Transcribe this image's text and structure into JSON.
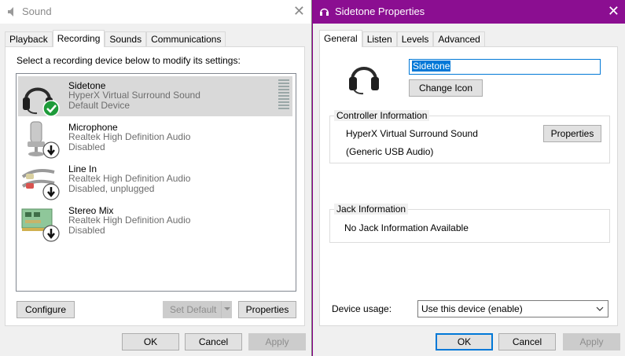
{
  "left_window": {
    "title": "Sound",
    "close_symbol": "✕",
    "tabs": [
      {
        "label": "Playback"
      },
      {
        "label": "Recording"
      },
      {
        "label": "Sounds"
      },
      {
        "label": "Communications"
      }
    ],
    "instruction": "Select a recording device below to modify its settings:",
    "devices": [
      {
        "name": "Sidetone",
        "driver": "HyperX Virtual Surround Sound",
        "status": "Default Device",
        "icon": "headset-icon",
        "badge": "check-badge-icon"
      },
      {
        "name": "Microphone",
        "driver": "Realtek High Definition Audio",
        "status": "Disabled",
        "icon": "microphone-icon",
        "badge": "disabled-arrow-badge-icon"
      },
      {
        "name": "Line In",
        "driver": "Realtek High Definition Audio",
        "status": "Disabled, unplugged",
        "icon": "line-in-cable-icon",
        "badge": "disabled-arrow-badge-icon"
      },
      {
        "name": "Stereo Mix",
        "driver": "Realtek High Definition Audio",
        "status": "Disabled",
        "icon": "sound-card-icon",
        "badge": "disabled-arrow-badge-icon"
      }
    ],
    "buttons": {
      "configure": "Configure",
      "set_default": "Set Default",
      "properties": "Properties",
      "ok": "OK",
      "cancel": "Cancel",
      "apply": "Apply"
    }
  },
  "right_window": {
    "title": "Sidetone Properties",
    "close_symbol": "✕",
    "tabs": [
      {
        "label": "General"
      },
      {
        "label": "Listen"
      },
      {
        "label": "Levels"
      },
      {
        "label": "Advanced"
      }
    ],
    "device_name_value": "Sidetone",
    "change_icon_label": "Change Icon",
    "controller": {
      "legend": "Controller Information",
      "name": "HyperX Virtual Surround Sound",
      "type": "(Generic USB Audio)",
      "properties_label": "Properties"
    },
    "jack": {
      "legend": "Jack Information",
      "text": "No Jack Information Available"
    },
    "device_usage": {
      "label": "Device usage:",
      "selected": "Use this device (enable)"
    },
    "buttons": {
      "ok": "OK",
      "cancel": "Cancel",
      "apply": "Apply"
    }
  },
  "colors": {
    "accent_purple": "#8b0e91",
    "selection_blue": "#0078d7",
    "check_green": "#1e9b3a"
  }
}
